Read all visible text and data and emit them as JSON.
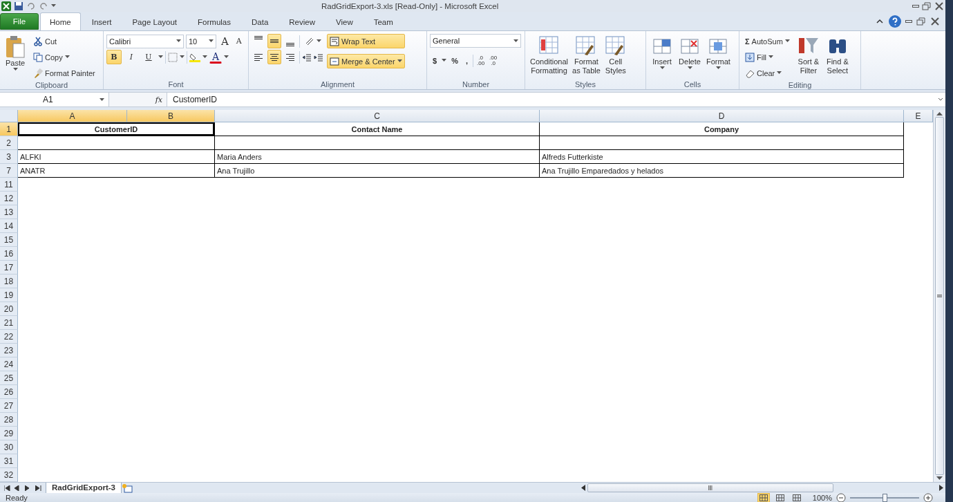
{
  "window": {
    "title": "RadGridExport-3.xls  [Read-Only]  -  Microsoft Excel"
  },
  "file_tab": "File",
  "tabs": [
    {
      "label": "Home",
      "selected": true
    },
    {
      "label": "Insert",
      "selected": false
    },
    {
      "label": "Page Layout",
      "selected": false
    },
    {
      "label": "Formulas",
      "selected": false
    },
    {
      "label": "Data",
      "selected": false
    },
    {
      "label": "Review",
      "selected": false
    },
    {
      "label": "View",
      "selected": false
    },
    {
      "label": "Team",
      "selected": false
    }
  ],
  "clipboard": {
    "label": "Clipboard",
    "paste": "Paste",
    "cut": "Cut",
    "copy": "Copy",
    "format_painter": "Format Painter"
  },
  "font": {
    "label": "Font",
    "font_name": "Calibri",
    "font_size": "10",
    "grow": "A",
    "shrink": "A",
    "font_color": "A",
    "styles": [
      {
        "glyph": "B",
        "on": true
      },
      {
        "glyph": "I",
        "on": false
      },
      {
        "glyph": "U",
        "on": false
      }
    ]
  },
  "alignment": {
    "label": "Alignment",
    "vertical": [
      {
        "selected": false
      },
      {
        "selected": true
      },
      {
        "selected": false
      }
    ],
    "horizontal": [
      {
        "selected": false
      },
      {
        "selected": true
      },
      {
        "selected": false
      }
    ],
    "wrap_text": {
      "label": "Wrap Text",
      "on": true
    },
    "merge_center": {
      "label": "Merge & Center",
      "on": true
    }
  },
  "number": {
    "label": "Number",
    "format": "General",
    "currency": "$",
    "percent": "%",
    "comma": ",",
    "increase_decimal": [
      ".0",
      ".00"
    ],
    "decrease_decimal": [
      ".00",
      ".0"
    ]
  },
  "styles": {
    "label": "Styles",
    "buttons": [
      {
        "lines": [
          "Conditional",
          "Formatting"
        ]
      },
      {
        "lines": [
          "Format",
          "as Table"
        ]
      },
      {
        "lines": [
          "Cell",
          "Styles"
        ]
      }
    ]
  },
  "cells": {
    "label": "Cells",
    "buttons": [
      "Insert",
      "Delete",
      "Format"
    ]
  },
  "editing": {
    "label": "Editing",
    "autosum_glyph": "Σ",
    "autosum": "AutoSum",
    "fill": "Fill",
    "clear": "Clear",
    "buttons": [
      {
        "lines": [
          "Sort &",
          "Filter"
        ]
      },
      {
        "lines": [
          "Find &",
          "Select"
        ]
      }
    ]
  },
  "name_box": "A1",
  "fx": "fx",
  "formula": "CustomerID",
  "columns": [
    {
      "label": "A",
      "selected": true
    },
    {
      "label": "B",
      "selected": true
    },
    {
      "label": "C",
      "selected": false
    },
    {
      "label": "D",
      "selected": false
    },
    {
      "label": "E",
      "selected": false
    }
  ],
  "table_rows": [
    {
      "header": "1",
      "selected": true,
      "kind": "heading",
      "cells": [
        "CustomerID",
        "Contact Name",
        "Company"
      ]
    },
    {
      "header": "2",
      "selected": false,
      "kind": "data"
    },
    {
      "header": "3",
      "selected": false,
      "kind": "data",
      "cells": [
        "ALFKI",
        "Maria Anders",
        "Alfreds Futterkiste"
      ]
    },
    {
      "header": "7",
      "selected": false,
      "kind": "data",
      "cells": [
        "ANATR",
        "Ana Trujillo",
        "Ana Trujillo Emparedados y helados"
      ]
    }
  ],
  "empty_rows": [
    "11",
    "12",
    "13",
    "14",
    "15",
    "16",
    "17",
    "18",
    "19",
    "20",
    "21",
    "22",
    "23",
    "24",
    "25",
    "26",
    "27",
    "28",
    "29",
    "30",
    "31",
    "32"
  ],
  "sheet_tabs": [
    {
      "label": "RadGridExport-3",
      "selected": true
    }
  ],
  "status": "Ready",
  "zoom": "100%",
  "zoom_level": {
    "level": 0.5
  },
  "views": [
    {
      "selected": true
    },
    {
      "selected": false
    },
    {
      "selected": false
    }
  ]
}
